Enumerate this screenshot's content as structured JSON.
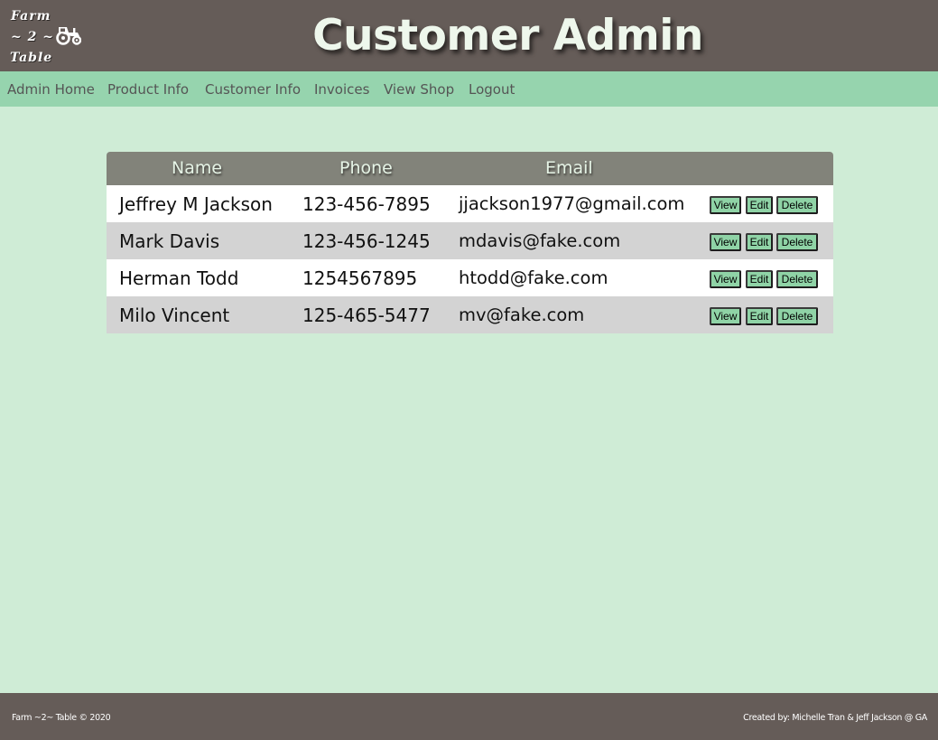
{
  "brand": {
    "logo_line1": "Farm",
    "logo_line2": "~ 2 ~",
    "logo_line3": "Table",
    "logo_icon": "tractor-icon"
  },
  "header": {
    "title": "Customer Admin"
  },
  "nav": {
    "items": [
      {
        "label": "Admin Home"
      },
      {
        "label": "Product Info"
      },
      {
        "label": "Customer Info"
      },
      {
        "label": "Invoices"
      },
      {
        "label": "View Shop"
      },
      {
        "label": "Logout"
      }
    ]
  },
  "table": {
    "headers": [
      "Name",
      "Phone",
      "Email"
    ],
    "rows": [
      {
        "name": "Jeffrey M Jackson",
        "phone": "123-456-7895",
        "email": "jjackson1977@gmail.com"
      },
      {
        "name": "Mark Davis",
        "phone": "123-456-1245",
        "email": "mdavis@fake.com"
      },
      {
        "name": "Herman Todd",
        "phone": "1254567895",
        "email": "htodd@fake.com"
      },
      {
        "name": "Milo Vincent",
        "phone": "125-465-5477",
        "email": "mv@fake.com"
      }
    ],
    "actions": {
      "view": "View",
      "edit": "Edit",
      "delete": "Delete"
    }
  },
  "footer": {
    "left": "Farm ~2~ Table © 2020",
    "right": "Created by: Michelle Tran & Jeff Jackson @ GA"
  },
  "colors": {
    "header_bg": "#655c58",
    "nav_bg": "#96d4ae",
    "page_bg": "#cfecd6",
    "table_header_bg": "#82837a",
    "button_bg": "#8fd3a6"
  }
}
